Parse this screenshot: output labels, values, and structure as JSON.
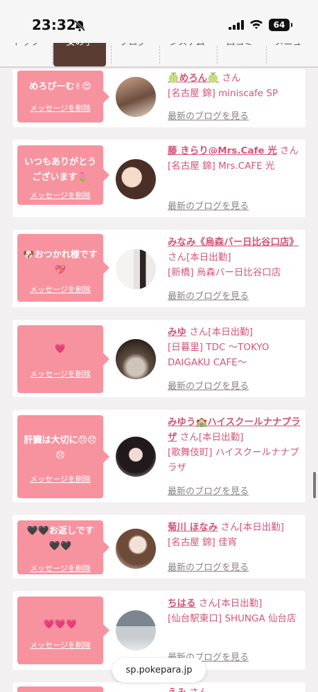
{
  "status_bar": {
    "time": "23:32",
    "battery": "64"
  },
  "nav": {
    "tabs": [
      "トップ",
      "女の子",
      "ブログ",
      "システム",
      "口コミ",
      "メニュー"
    ]
  },
  "delete_label": "メッセージを削除",
  "blog_label": "最新のブログを見る",
  "cards": [
    {
      "message": "めろぴーむ✌😍",
      "name": "🍈めろん🍈",
      "san": "さん",
      "status": "",
      "shop": "[名古屋 錦] miniscafe SP"
    },
    {
      "message": "いつもありがとうございます🌷",
      "name": "藤 きらり@Mrs.Cafe 光",
      "san": "さん",
      "status": "",
      "shop": "[名古屋 錦] Mrs.CAFE 光"
    },
    {
      "message": "🐶おつかれ様です💖",
      "name": "みなみ《烏森バー日比谷口店》",
      "san": "さん",
      "status": "[本日出勤]",
      "shop": "[新橋] 烏森バー日比谷口店"
    },
    {
      "message": "💗",
      "name": "みゆ",
      "san": "さん",
      "status": "[本日出勤]",
      "shop": "[日暮里] TDC 〜TOKYO DAIGAKU CAFE〜"
    },
    {
      "message": "肝臓は大切に😞😞😞",
      "name": "みゆう🏫ハイスクールナナプラザ",
      "san": "さん",
      "status": "[本日出勤]",
      "shop": "[歌舞伎町] ハイスクールナナプラザ"
    },
    {
      "message": "🖤🖤お返しです🖤🖤",
      "name": "菊川 ほなみ",
      "san": "さん",
      "status": "[本日出勤]",
      "shop": "[名古屋 錦] 佳宵"
    },
    {
      "message": "💗💗💗",
      "name": "ちはる",
      "san": "さん",
      "status": "[本日出勤]",
      "shop": "[仙台駅東口] SHUNGA 仙台店"
    },
    {
      "message": "",
      "name": "えみ",
      "san": "さん",
      "status": "",
      "shop": ""
    }
  ],
  "url": "sp.pokepara.jp",
  "colors": {
    "accent": "#d4547a",
    "bubble": "#f7939f",
    "nav_active": "#5b3c33"
  }
}
